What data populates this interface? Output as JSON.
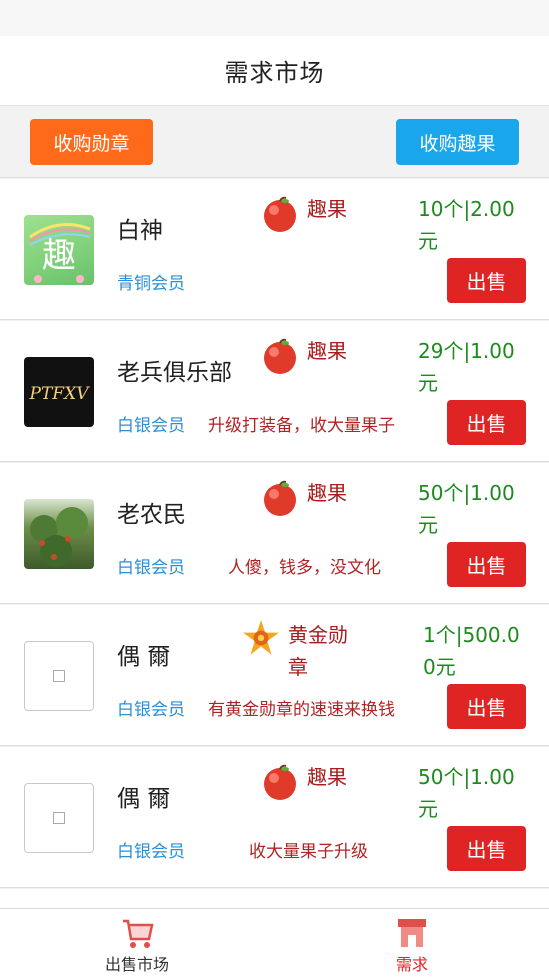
{
  "header": {
    "title": "需求市场"
  },
  "actions": {
    "buy_medal": "收购勋章",
    "buy_fruit": "收购趣果"
  },
  "colors": {
    "orange": "#ff6a1a",
    "blue": "#1aa6ea",
    "red": "#e02424",
    "green": "#1e8a1e"
  },
  "rows": [
    {
      "username": "白神",
      "level": "青铜会员",
      "note": "",
      "goods": "趣果",
      "goods_icon": "apple-icon",
      "price": "10个|2.00元",
      "sell": "出售"
    },
    {
      "username": "老兵俱乐部",
      "level": "白银会员",
      "note": "升级打装备，收大量果子",
      "goods": "趣果",
      "goods_icon": "apple-icon",
      "price": "29个|1.00元",
      "sell": "出售"
    },
    {
      "username": "老农民",
      "level": "白银会员",
      "note": "人傻，钱多，没文化",
      "goods": "趣果",
      "goods_icon": "apple-icon",
      "price": "50个|1.00元",
      "sell": "出售"
    },
    {
      "username": "偶 爾",
      "level": "白银会员",
      "note": "有黄金勋章的速速来换钱",
      "goods": "黄金勋章",
      "goods_icon": "gold-medal-icon",
      "price": "1个|500.00元",
      "sell": "出售"
    },
    {
      "username": "偶 爾",
      "level": "白银会员",
      "note": "收大量果子升级",
      "goods": "趣果",
      "goods_icon": "apple-icon",
      "price": "50个|1.00元",
      "sell": "出售"
    }
  ],
  "avatars": {
    "row0": "趣"
  },
  "avatar_logo": {
    "row1": "PTFXV"
  },
  "tabbar": {
    "sell_market": "出售市场",
    "demand_market": "需求"
  }
}
